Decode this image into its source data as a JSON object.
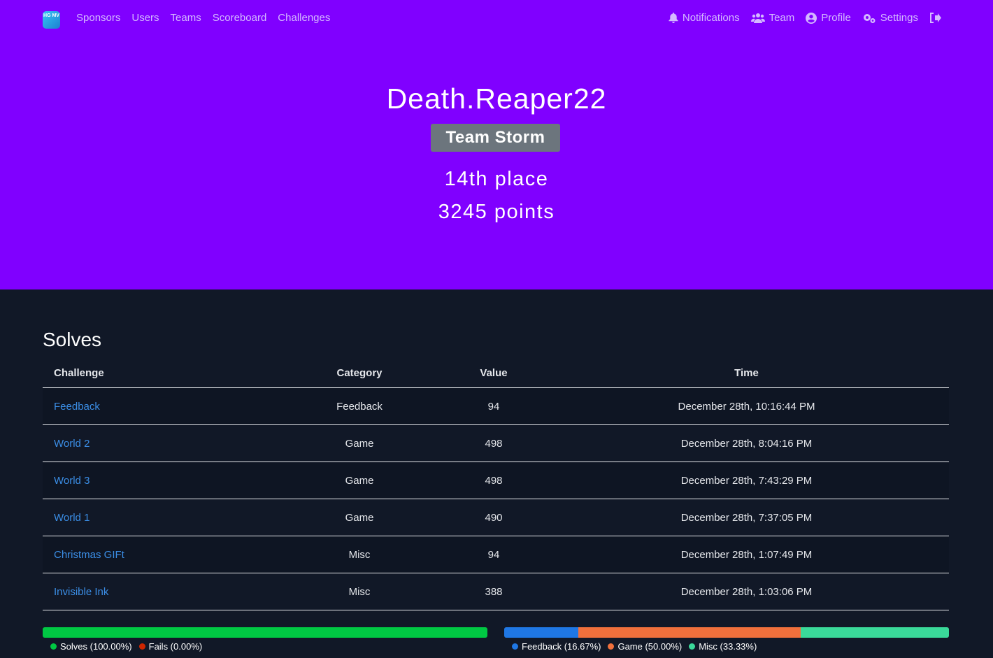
{
  "nav": {
    "logo_text": "HG MV",
    "left": [
      "Sponsors",
      "Users",
      "Teams",
      "Scoreboard",
      "Challenges"
    ],
    "right": [
      {
        "label": "Notifications",
        "icon": "bell-icon"
      },
      {
        "label": "Team",
        "icon": "users-icon"
      },
      {
        "label": "Profile",
        "icon": "user-circle-icon"
      },
      {
        "label": "Settings",
        "icon": "cogs-icon"
      },
      {
        "label": "",
        "icon": "logout-icon"
      }
    ]
  },
  "profile": {
    "name": "Death.Reaper22",
    "team": "Team Storm",
    "place": "14th place",
    "points": "3245 points"
  },
  "solves": {
    "title": "Solves",
    "headers": [
      "Challenge",
      "Category",
      "Value",
      "Time"
    ],
    "rows": [
      [
        "Feedback",
        "Feedback",
        "94",
        "December 28th, 10:16:44 PM"
      ],
      [
        "World 2",
        "Game",
        "498",
        "December 28th, 8:04:16 PM"
      ],
      [
        "World 3",
        "Game",
        "498",
        "December 28th, 7:43:29 PM"
      ],
      [
        "World 1",
        "Game",
        "490",
        "December 28th, 7:37:05 PM"
      ],
      [
        "Christmas GIFt",
        "Misc",
        "94",
        "December 28th, 1:07:49 PM"
      ],
      [
        "Invisible Ink",
        "Misc",
        "388",
        "December 28th, 1:03:06 PM"
      ]
    ]
  },
  "solve_bar": {
    "segments": [
      {
        "label": "Solves (100.00%)",
        "value": 100.0,
        "color": "#00c843"
      },
      {
        "label": "Fails (0.00%)",
        "value": 0.0,
        "color": "#cf2600"
      }
    ]
  },
  "category_bar": {
    "segments": [
      {
        "label": "Feedback (16.67%)",
        "value": 16.67,
        "color": "#1f77e4"
      },
      {
        "label": "Game (50.00%)",
        "value": 50.0,
        "color": "#f0703c"
      },
      {
        "label": "Misc (33.33%)",
        "value": 33.33,
        "color": "#3ad99a"
      }
    ]
  }
}
